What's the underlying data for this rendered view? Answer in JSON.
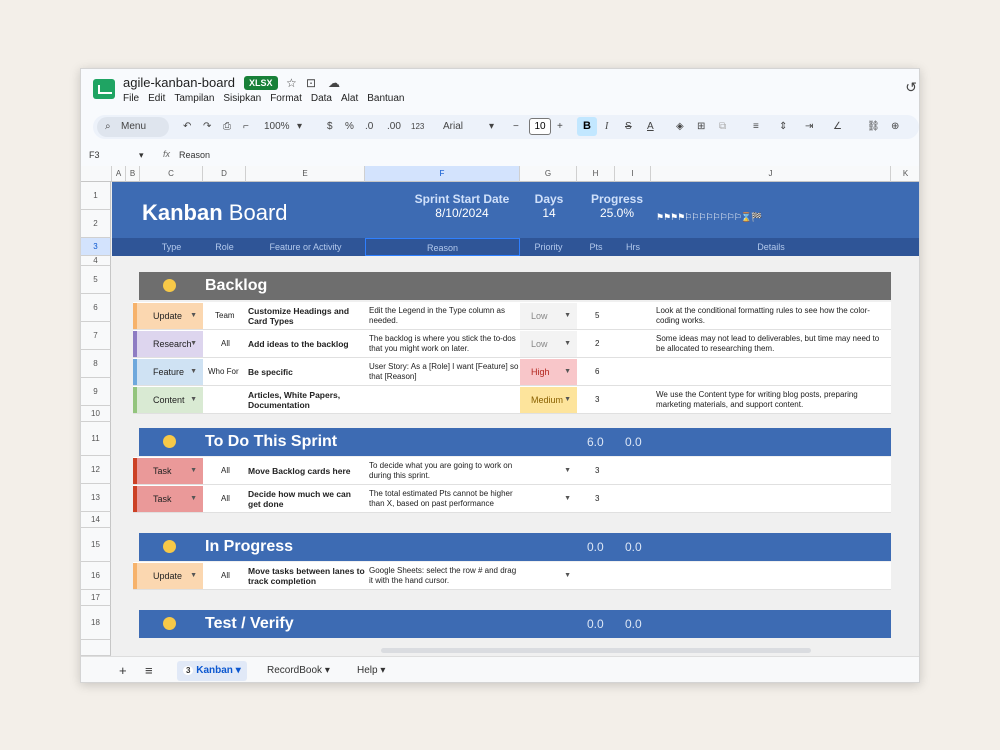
{
  "app": {
    "doc_title": "agile-kanban-board",
    "file_badge": "XLSX",
    "menu": [
      "File",
      "Edit",
      "Tampilan",
      "Sisipkan",
      "Format",
      "Data",
      "Alat",
      "Bantuan"
    ]
  },
  "toolbar": {
    "search_label": "Menu",
    "zoom": "100%",
    "currency": "$",
    "percent": "%",
    "dec_decrease": ".0",
    "dec_increase": ".00",
    "num_format": "123",
    "font": "Arial",
    "font_size": "10",
    "bold": "B",
    "italic": "I",
    "strike": "S",
    "text_color": "A"
  },
  "formula_bar": {
    "cell_ref": "F3",
    "fx": "fx",
    "value": "Reason"
  },
  "columns": [
    "A",
    "B",
    "C",
    "D",
    "E",
    "F",
    "G",
    "H",
    "I",
    "J",
    "K"
  ],
  "rows": [
    "1",
    "2",
    "3",
    "4",
    "5",
    "6",
    "7",
    "8",
    "9",
    "10",
    "11",
    "12",
    "13",
    "14",
    "15",
    "16",
    "17",
    "18"
  ],
  "header": {
    "title_bold": "Kanban",
    "title_light": " Board",
    "sprint_label": "Sprint Start Date",
    "sprint_value": "8/10/2024",
    "days_label": "Days",
    "days_value": "14",
    "progress_label": "Progress",
    "progress_value": "25.0%",
    "progress_flags": "⚑⚑⚑⚑⚐⚐⚐⚐⚐⚐⚐⚐⌛🏁"
  },
  "col_names": {
    "type": "Type",
    "role": "Role",
    "feature": "Feature or Activity",
    "reason": "Reason",
    "priority": "Priority",
    "pts": "Pts",
    "hrs": "Hrs",
    "details": "Details"
  },
  "lanes": {
    "backlog": {
      "name": "Backlog"
    },
    "todo": {
      "name": "To Do This Sprint",
      "pts": "6.0",
      "hrs": "0.0"
    },
    "inprogress": {
      "name": "In Progress",
      "pts": "0.0",
      "hrs": "0.0"
    },
    "test": {
      "name": "Test / Verify",
      "pts": "0.0",
      "hrs": "0.0"
    }
  },
  "backlog_rows": [
    {
      "type": "Update",
      "role": "Team",
      "feature": "Customize Headings and Card Types",
      "reason": "Edit the Legend in the Type column as needed.",
      "priority": "Low",
      "pts": "5",
      "details": "Look at the conditional formatting rules to see how the color-coding works."
    },
    {
      "type": "Research",
      "role": "All",
      "feature": "Add ideas to the backlog",
      "reason": "The backlog is where you stick the to-dos that you might work on later.",
      "priority": "Low",
      "pts": "2",
      "details": "Some ideas may not lead to deliverables, but time may need to be allocated to researching them."
    },
    {
      "type": "Feature",
      "role": "Who For",
      "feature": "Be specific",
      "reason": "User Story: As a [Role] I want [Feature] so that [Reason]",
      "priority": "High",
      "pts": "6",
      "details": ""
    },
    {
      "type": "Content",
      "role": "",
      "feature": "Articles, White Papers, Documentation",
      "reason": "",
      "priority": "Medium",
      "pts": "3",
      "details": "We use the Content type for writing blog posts, preparing marketing materials, and support content."
    }
  ],
  "todo_rows": [
    {
      "type": "Task",
      "role": "All",
      "feature": "Move Backlog cards here",
      "reason": "To decide what you are going to work on during this sprint.",
      "pts": "3"
    },
    {
      "type": "Task",
      "role": "All",
      "feature": "Decide how much we can get done",
      "reason": "The total estimated Pts cannot be higher than X, based on past performance",
      "pts": "3"
    }
  ],
  "inprogress_rows": [
    {
      "type": "Update",
      "role": "All",
      "feature": "Move tasks between lanes to track completion",
      "reason": "Google Sheets: select the row # and drag it with the hand cursor.",
      "pts": ""
    }
  ],
  "sheets": {
    "add": "+",
    "list": "≡",
    "kanban_count": "3",
    "kanban": "Kanban",
    "recordbook": "RecordBook",
    "help": "Help"
  },
  "colors": {
    "update": "#f6b26b",
    "research": "#b4a7d6",
    "feature": "#9fc5e8",
    "content": "#b6d7a8",
    "task": "#ea9999",
    "lane_blue": "#3d6bb3",
    "lane_gray": "#6e6e6e"
  }
}
